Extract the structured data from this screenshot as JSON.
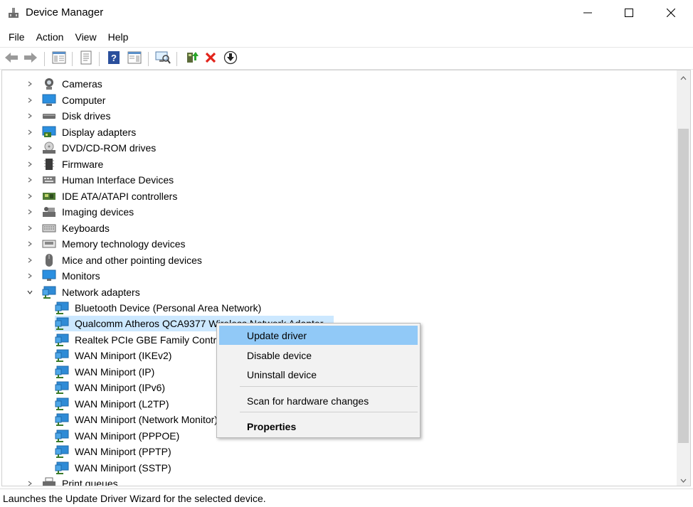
{
  "window": {
    "title": "Device Manager",
    "controls": {
      "minimize": "minimize",
      "maximize": "maximize",
      "close": "close"
    }
  },
  "menubar": [
    "File",
    "Action",
    "View",
    "Help"
  ],
  "toolbar": {
    "buttons": [
      "back-arrow-icon",
      "forward-arrow-icon",
      "show-hide-console-tree-icon",
      "properties-sheet-icon",
      "help-icon",
      "action-pane-icon",
      "scan-hardware-icon",
      "update-driver-icon",
      "uninstall-device-icon",
      "download-driver-icon"
    ]
  },
  "tree": {
    "categories": [
      {
        "label": "Cameras",
        "icon": "camera-icon"
      },
      {
        "label": "Computer",
        "icon": "computer-icon"
      },
      {
        "label": "Disk drives",
        "icon": "disk-drive-icon"
      },
      {
        "label": "Display adapters",
        "icon": "display-adapter-icon"
      },
      {
        "label": "DVD/CD-ROM drives",
        "icon": "dvd-drive-icon"
      },
      {
        "label": "Firmware",
        "icon": "firmware-icon"
      },
      {
        "label": "Human Interface Devices",
        "icon": "hid-icon"
      },
      {
        "label": "IDE ATA/ATAPI controllers",
        "icon": "ide-controller-icon"
      },
      {
        "label": "Imaging devices",
        "icon": "imaging-icon"
      },
      {
        "label": "Keyboards",
        "icon": "keyboard-icon"
      },
      {
        "label": "Memory technology devices",
        "icon": "memory-icon"
      },
      {
        "label": "Mice and other pointing devices",
        "icon": "mouse-icon"
      },
      {
        "label": "Monitors",
        "icon": "monitor-icon"
      },
      {
        "label": "Network adapters",
        "icon": "network-adapter-icon",
        "expanded": true
      },
      {
        "label": "Print queues",
        "icon": "printer-icon"
      }
    ],
    "network_children": [
      "Bluetooth Device (Personal Area Network)",
      "Qualcomm Atheros QCA9377 Wireless Network Adapter",
      "Realtek PCIe GBE Family Controller",
      "WAN Miniport (IKEv2)",
      "WAN Miniport (IP)",
      "WAN Miniport (IPv6)",
      "WAN Miniport (L2TP)",
      "WAN Miniport (Network Monitor)",
      "WAN Miniport (PPPOE)",
      "WAN Miniport (PPTP)",
      "WAN Miniport (SSTP)"
    ],
    "selected_child": "Qualcomm Atheros QCA9377 Wireless Network Adapter"
  },
  "context_menu": {
    "items": [
      {
        "label": "Update driver",
        "highlighted": true
      },
      {
        "label": "Disable device"
      },
      {
        "label": "Uninstall device"
      },
      {
        "label": "Scan for hardware changes"
      },
      {
        "label": "Properties",
        "bold": true
      }
    ]
  },
  "status": {
    "text": "Launches the Update Driver Wizard for the selected device."
  },
  "colors": {
    "selection": "#cce8ff",
    "menu_highlight": "#91c9f7",
    "net_icon": "#2f8bd6"
  }
}
